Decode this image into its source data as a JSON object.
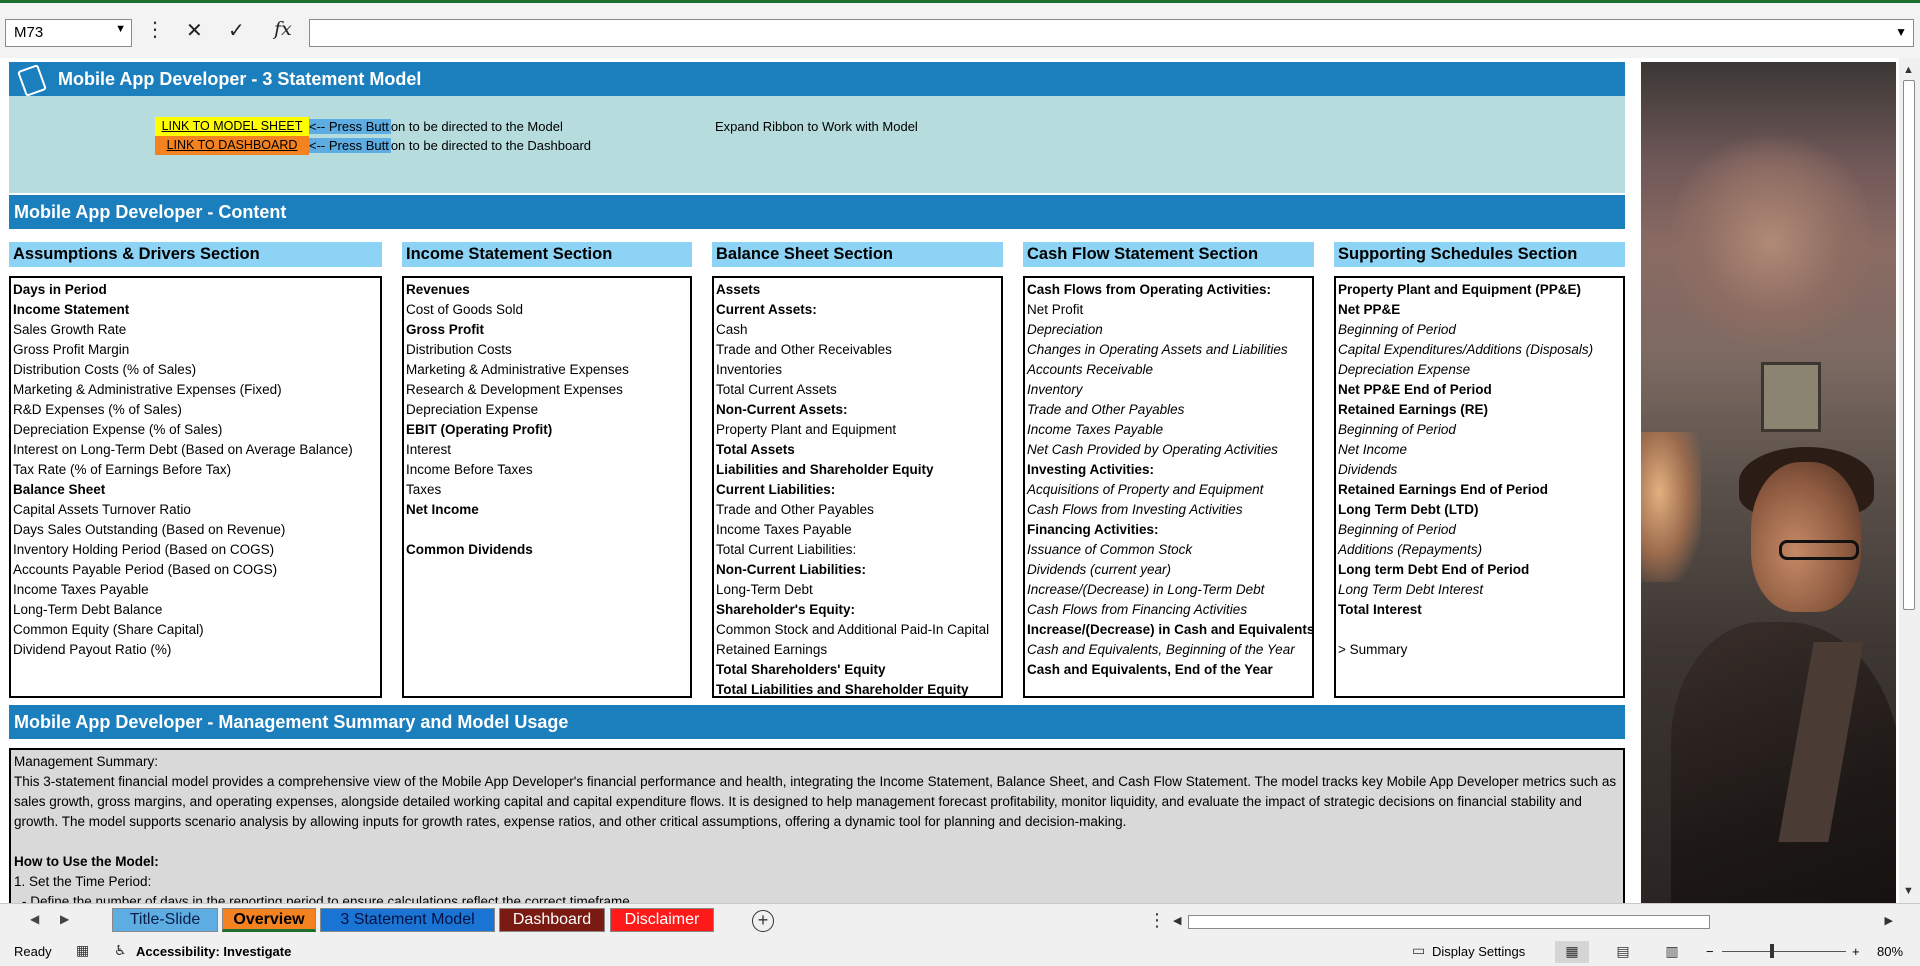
{
  "formula_bar": {
    "name_box": "M73",
    "cancel_icon": "✕",
    "enter_icon": "✓",
    "fx_label": "fx",
    "formula_value": ""
  },
  "header": {
    "title": "Mobile App Developer - 3 Statement Model",
    "link_model_label": "LINK TO MODEL SHEET",
    "link_model_hint_arrow": "<-- Press Butt",
    "link_model_hint_rest": "on to be directed to the Model",
    "link_dashboard_label": "LINK TO DASHBOARD",
    "link_dashboard_hint_arrow": "<-- Press Butt",
    "link_dashboard_hint_rest": "on to be directed to the Dashboard",
    "expand_note": "Expand Ribbon to Work with Model"
  },
  "content_title": "Mobile App Developer - Content",
  "sections": [
    {
      "title": "Assumptions & Drivers Section",
      "items": [
        {
          "t": "Days in Period",
          "s": "b"
        },
        {
          "t": "Income Statement",
          "s": "b"
        },
        {
          "t": "Sales Growth Rate",
          "s": "n"
        },
        {
          "t": "Gross Profit Margin",
          "s": "n"
        },
        {
          "t": "Distribution Costs (% of Sales)",
          "s": "n"
        },
        {
          "t": "Marketing & Administrative Expenses (Fixed)",
          "s": "n"
        },
        {
          "t": "R&D Expenses (% of Sales)",
          "s": "n"
        },
        {
          "t": "Depreciation Expense (% of Sales)",
          "s": "n"
        },
        {
          "t": "Interest on Long-Term Debt (Based on Average Balance)",
          "s": "n"
        },
        {
          "t": "Tax Rate (% of Earnings Before Tax)",
          "s": "n"
        },
        {
          "t": "Balance Sheet",
          "s": "b"
        },
        {
          "t": "Capital Assets Turnover Ratio",
          "s": "n"
        },
        {
          "t": "Days Sales Outstanding (Based on Revenue)",
          "s": "n"
        },
        {
          "t": "Inventory Holding Period (Based on COGS)",
          "s": "n"
        },
        {
          "t": "Accounts Payable Period (Based on COGS)",
          "s": "n"
        },
        {
          "t": "Income Taxes Payable",
          "s": "n"
        },
        {
          "t": "Long-Term Debt Balance",
          "s": "n"
        },
        {
          "t": "Common Equity (Share Capital)",
          "s": "n"
        },
        {
          "t": "Dividend Payout Ratio (%)",
          "s": "n"
        }
      ]
    },
    {
      "title": "Income Statement Section",
      "items": [
        {
          "t": "Revenues",
          "s": "b"
        },
        {
          "t": "Cost of Goods Sold",
          "s": "n"
        },
        {
          "t": "Gross Profit",
          "s": "b"
        },
        {
          "t": "Distribution Costs",
          "s": "n"
        },
        {
          "t": "Marketing & Administrative Expenses",
          "s": "n"
        },
        {
          "t": "Research & Development Expenses",
          "s": "n"
        },
        {
          "t": "Depreciation Expense",
          "s": "n"
        },
        {
          "t": "EBIT (Operating Profit)",
          "s": "b"
        },
        {
          "t": "Interest",
          "s": "n"
        },
        {
          "t": "Income Before Taxes",
          "s": "n"
        },
        {
          "t": "Taxes",
          "s": "n"
        },
        {
          "t": "Net Income",
          "s": "b"
        },
        {
          "t": "",
          "s": "e"
        },
        {
          "t": "Common Dividends",
          "s": "b"
        }
      ]
    },
    {
      "title": "Balance Sheet Section",
      "items": [
        {
          "t": "Assets",
          "s": "b"
        },
        {
          "t": "Current Assets:",
          "s": "b"
        },
        {
          "t": "Cash",
          "s": "n"
        },
        {
          "t": "Trade and Other Receivables",
          "s": "n"
        },
        {
          "t": "Inventories",
          "s": "n"
        },
        {
          "t": "Total Current Assets",
          "s": "n"
        },
        {
          "t": "Non-Current Assets:",
          "s": "b"
        },
        {
          "t": "Property Plant and Equipment",
          "s": "n"
        },
        {
          "t": "Total Assets",
          "s": "b"
        },
        {
          "t": "Liabilities and Shareholder Equity",
          "s": "b"
        },
        {
          "t": "Current Liabilities:",
          "s": "b"
        },
        {
          "t": "Trade and Other Payables",
          "s": "n"
        },
        {
          "t": "Income Taxes Payable",
          "s": "n"
        },
        {
          "t": "Total Current Liabilities:",
          "s": "n"
        },
        {
          "t": "Non-Current Liabilities:",
          "s": "b"
        },
        {
          "t": "Long-Term Debt",
          "s": "n"
        },
        {
          "t": "Shareholder's Equity:",
          "s": "b"
        },
        {
          "t": "Common Stock and Additional Paid-In Capital",
          "s": "n"
        },
        {
          "t": "Retained Earnings",
          "s": "n"
        },
        {
          "t": "Total Shareholders' Equity",
          "s": "b"
        },
        {
          "t": "Total Liabilities and Shareholder Equity",
          "s": "b"
        }
      ]
    },
    {
      "title": "Cash Flow Statement Section",
      "items": [
        {
          "t": "Cash Flows from Operating Activities:",
          "s": "b"
        },
        {
          "t": "Net Profit",
          "s": "n"
        },
        {
          "t": "Depreciation",
          "s": "i"
        },
        {
          "t": "Changes in Operating Assets and Liabilities",
          "s": "i"
        },
        {
          "t": "Accounts Receivable",
          "s": "i"
        },
        {
          "t": "Inventory",
          "s": "i"
        },
        {
          "t": "Trade and Other Payables",
          "s": "i"
        },
        {
          "t": "Income Taxes Payable",
          "s": "i"
        },
        {
          "t": "Net Cash Provided by Operating Activities",
          "s": "i"
        },
        {
          "t": "Investing Activities:",
          "s": "b"
        },
        {
          "t": "Acquisitions of Property and Equipment",
          "s": "i"
        },
        {
          "t": "Cash Flows from Investing Activities",
          "s": "i"
        },
        {
          "t": "Financing Activities:",
          "s": "b"
        },
        {
          "t": "Issuance of Common Stock",
          "s": "i"
        },
        {
          "t": "Dividends (current year)",
          "s": "i"
        },
        {
          "t": "Increase/(Decrease) in Long-Term Debt",
          "s": "i"
        },
        {
          "t": "Cash Flows from Financing Activities",
          "s": "i"
        },
        {
          "t": "Increase/(Decrease) in Cash and Equivalents",
          "s": "b"
        },
        {
          "t": "Cash and Equivalents, Beginning of the Year",
          "s": "i"
        },
        {
          "t": "Cash and Equivalents, End of the Year",
          "s": "b"
        }
      ]
    },
    {
      "title": "Supporting Schedules Section",
      "items": [
        {
          "t": "Property Plant and Equipment (PP&E)",
          "s": "b"
        },
        {
          "t": "Net PP&E",
          "s": "b"
        },
        {
          "t": "Beginning of Period",
          "s": "i"
        },
        {
          "t": "Capital Expenditures/Additions (Disposals)",
          "s": "i"
        },
        {
          "t": "Depreciation Expense",
          "s": "i"
        },
        {
          "t": "Net PP&E End of Period",
          "s": "b"
        },
        {
          "t": "Retained Earnings (RE)",
          "s": "b"
        },
        {
          "t": "Beginning of Period",
          "s": "i"
        },
        {
          "t": "Net Income",
          "s": "i"
        },
        {
          "t": "Dividends",
          "s": "i"
        },
        {
          "t": "Retained Earnings End of Period",
          "s": "b"
        },
        {
          "t": "Long Term Debt (LTD)",
          "s": "b"
        },
        {
          "t": "Beginning of Period",
          "s": "i"
        },
        {
          "t": "Additions (Repayments)",
          "s": "i"
        },
        {
          "t": "Long term Debt End of Period",
          "s": "b"
        },
        {
          "t": "Long Term Debt Interest",
          "s": "i"
        },
        {
          "t": "Total Interest",
          "s": "b"
        },
        {
          "t": "",
          "s": "e"
        },
        {
          "t": "> Summary",
          "s": "n"
        }
      ]
    }
  ],
  "management": {
    "title": "Mobile App Developer - Management Summary and Model Usage",
    "summary_label": "Management Summary:",
    "summary_text": "This 3-statement financial model provides a comprehensive view of the Mobile App Developer's financial performance and health, integrating the Income Statement, Balance Sheet, and Cash Flow Statement. The model tracks key Mobile App Developer metrics such as sales growth, gross margins, and operating expenses, alongside detailed working capital and capital expenditure flows. It is designed to help management forecast profitability, monitor liquidity, and evaluate the impact of strategic decisions on financial stability and growth. The model supports scenario analysis by allowing inputs for growth rates, expense ratios, and other critical assumptions, offering a dynamic tool for planning and decision-making.",
    "how_to_label": "How to Use the Model:",
    "step1": "1. Set the Time Period:",
    "step1_detail": "- Define the number of days in the reporting period to ensure calculations reflect the correct timeframe."
  },
  "tabs": [
    {
      "label": "Title-Slide",
      "key": "title"
    },
    {
      "label": "Overview",
      "key": "over"
    },
    {
      "label": "3 Statement Model",
      "key": "3sm"
    },
    {
      "label": "Dashboard",
      "key": "dash"
    },
    {
      "label": "Disclaimer",
      "key": "disc"
    }
  ],
  "status": {
    "ready": "Ready",
    "accessibility": "Accessibility: Investigate",
    "display_settings": "Display Settings",
    "zoom": "80%"
  }
}
